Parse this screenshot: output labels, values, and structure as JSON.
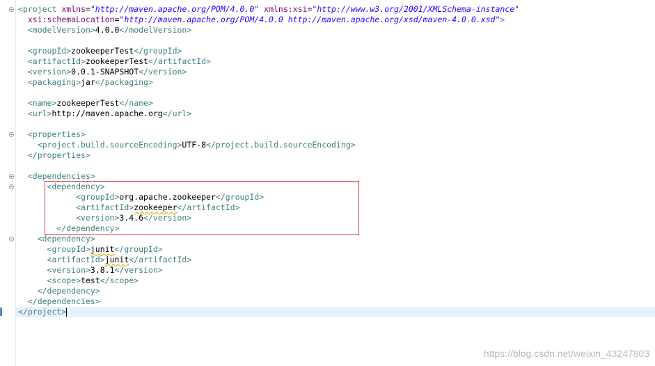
{
  "lines": [
    [
      {
        "c": "t",
        "v": "<project "
      },
      {
        "c": "an",
        "v": "xmlns"
      },
      {
        "c": "tx",
        "v": "="
      },
      {
        "c": "av",
        "v": "\"http://maven.apache.org/POM/4.0.0\""
      },
      {
        "c": "tx",
        "v": " "
      },
      {
        "c": "an",
        "v": "xmlns:xsi"
      },
      {
        "c": "tx",
        "v": "="
      },
      {
        "c": "av",
        "v": "\"http://www.w3.org/2001/XMLSchema-instance\""
      }
    ],
    [
      {
        "c": "tx",
        "v": "  "
      },
      {
        "c": "an",
        "v": "xsi:schemaLocation"
      },
      {
        "c": "tx",
        "v": "="
      },
      {
        "c": "av",
        "v": "\"http://maven.apache.org/POM/4.0.0 http://maven.apache.org/xsd/maven-4.0.0.xsd\""
      },
      {
        "c": "t",
        "v": ">"
      }
    ],
    [
      {
        "c": "tx",
        "v": "  "
      },
      {
        "c": "t",
        "v": "<modelVersion>"
      },
      {
        "c": "tx",
        "v": "4.0.0"
      },
      {
        "c": "t",
        "v": "</modelVersion>"
      }
    ],
    [],
    [
      {
        "c": "tx",
        "v": "  "
      },
      {
        "c": "t",
        "v": "<groupId>"
      },
      {
        "c": "tx",
        "v": "zookeeperTest"
      },
      {
        "c": "t",
        "v": "</groupId>"
      }
    ],
    [
      {
        "c": "tx",
        "v": "  "
      },
      {
        "c": "t",
        "v": "<artifactId>"
      },
      {
        "c": "tx",
        "v": "zookeeperTest"
      },
      {
        "c": "t",
        "v": "</artifactId>"
      }
    ],
    [
      {
        "c": "tx",
        "v": "  "
      },
      {
        "c": "t",
        "v": "<version>"
      },
      {
        "c": "tx",
        "v": "0.0.1-SNAPSHOT"
      },
      {
        "c": "t",
        "v": "</version>"
      }
    ],
    [
      {
        "c": "tx",
        "v": "  "
      },
      {
        "c": "t",
        "v": "<packaging>"
      },
      {
        "c": "tx",
        "v": "jar"
      },
      {
        "c": "t",
        "v": "</packaging>"
      }
    ],
    [],
    [
      {
        "c": "tx",
        "v": "  "
      },
      {
        "c": "t",
        "v": "<name>"
      },
      {
        "c": "tx",
        "v": "zookeeperTest"
      },
      {
        "c": "t",
        "v": "</name>"
      }
    ],
    [
      {
        "c": "tx",
        "v": "  "
      },
      {
        "c": "t",
        "v": "<url>"
      },
      {
        "c": "tx",
        "v": "http://maven.apache.org"
      },
      {
        "c": "t",
        "v": "</url>"
      }
    ],
    [],
    [
      {
        "c": "tx",
        "v": "  "
      },
      {
        "c": "t",
        "v": "<properties>"
      }
    ],
    [
      {
        "c": "tx",
        "v": "    "
      },
      {
        "c": "t",
        "v": "<project.build.sourceEncoding>"
      },
      {
        "c": "tx",
        "v": "UTF-8"
      },
      {
        "c": "t",
        "v": "</project.build.sourceEncoding>"
      }
    ],
    [
      {
        "c": "tx",
        "v": "  "
      },
      {
        "c": "t",
        "v": "</properties>"
      }
    ],
    [],
    [
      {
        "c": "tx",
        "v": "  "
      },
      {
        "c": "t",
        "v": "<dependencies>"
      }
    ],
    [
      {
        "c": "tx",
        "v": "      "
      },
      {
        "c": "t",
        "v": "<dependency>"
      }
    ],
    [
      {
        "c": "tx",
        "v": "            "
      },
      {
        "c": "t",
        "v": "<groupId>"
      },
      {
        "c": "tx",
        "v": "org.apache.zookeeper"
      },
      {
        "c": "t",
        "v": "</groupId>"
      }
    ],
    [
      {
        "c": "tx",
        "v": "            "
      },
      {
        "c": "t",
        "v": "<artifactId>"
      },
      {
        "c": "sq",
        "v": "zookeeper"
      },
      {
        "c": "t",
        "v": "</artifactId>"
      }
    ],
    [
      {
        "c": "tx",
        "v": "            "
      },
      {
        "c": "t",
        "v": "<version>"
      },
      {
        "c": "tx",
        "v": "3.4.6"
      },
      {
        "c": "t",
        "v": "</version>"
      }
    ],
    [
      {
        "c": "tx",
        "v": "        "
      },
      {
        "c": "t",
        "v": "</dependency>"
      }
    ],
    [
      {
        "c": "tx",
        "v": "    "
      },
      {
        "c": "t",
        "v": "<dependency>"
      }
    ],
    [
      {
        "c": "tx",
        "v": "      "
      },
      {
        "c": "t",
        "v": "<groupId>"
      },
      {
        "c": "sq",
        "v": "junit"
      },
      {
        "c": "t",
        "v": "</groupId>"
      }
    ],
    [
      {
        "c": "tx",
        "v": "      "
      },
      {
        "c": "t",
        "v": "<artifactId>"
      },
      {
        "c": "sq",
        "v": "junit"
      },
      {
        "c": "t",
        "v": "</artifactId>"
      }
    ],
    [
      {
        "c": "tx",
        "v": "      "
      },
      {
        "c": "t",
        "v": "<version>"
      },
      {
        "c": "tx",
        "v": "3.8.1"
      },
      {
        "c": "t",
        "v": "</version>"
      }
    ],
    [
      {
        "c": "tx",
        "v": "      "
      },
      {
        "c": "t",
        "v": "<scope>"
      },
      {
        "c": "tx",
        "v": "test"
      },
      {
        "c": "t",
        "v": "</scope>"
      }
    ],
    [
      {
        "c": "tx",
        "v": "    "
      },
      {
        "c": "t",
        "v": "</dependency>"
      }
    ],
    [
      {
        "c": "tx",
        "v": "  "
      },
      {
        "c": "t",
        "v": "</dependencies>"
      }
    ],
    [
      {
        "c": "t",
        "v": "</project>"
      },
      {
        "c": "caret",
        "v": ""
      }
    ]
  ],
  "fold_lines": [
    0,
    12,
    16,
    17,
    22
  ],
  "current_line": 29,
  "highlighted_block": {
    "first_line": 17,
    "last_line": 21
  },
  "watermark": "https://blog.csdn.net/weixin_43247803",
  "colors": {
    "tag": "#3f7f7f",
    "attribute_name": "#7f007f",
    "attribute_value": "#2a00ff",
    "highlight_border": "#d63a3a",
    "current_line_bg": "#e8f2fe"
  }
}
